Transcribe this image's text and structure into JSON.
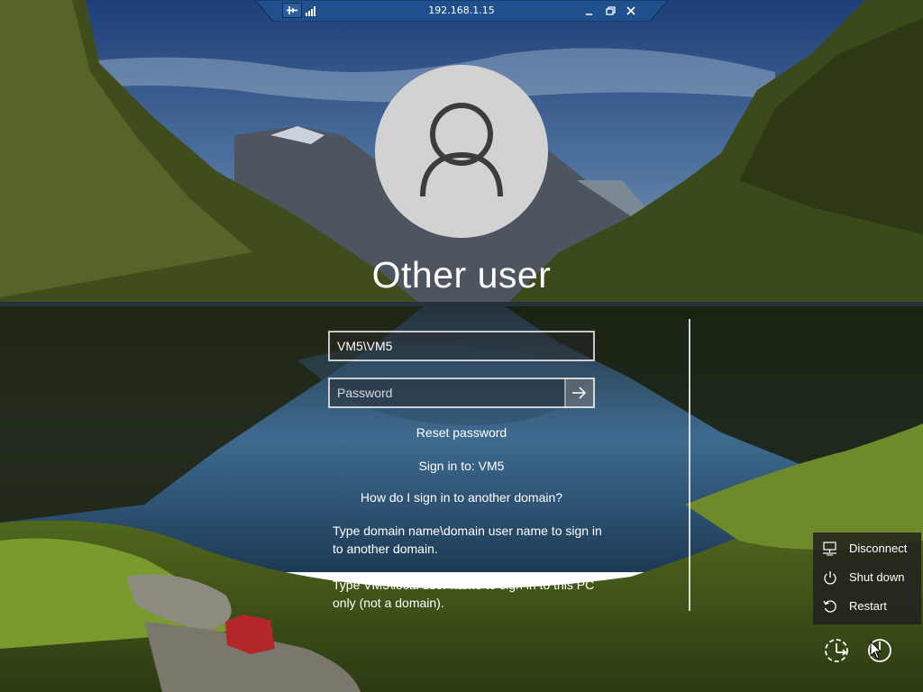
{
  "rdp_bar": {
    "title": "192.168.1.15"
  },
  "login": {
    "user_display_name": "Other user",
    "username_value": "VM5\\VM5",
    "password_placeholder": "Password",
    "reset_password": "Reset password",
    "sign_in_to": "Sign in to: VM5",
    "other_domain_link": "How do I sign in to another domain?",
    "info_domain": "Type domain name\\domain user name to sign in to another domain.",
    "info_local": "Type VM5\\local user name to sign in to this PC only (not a domain)."
  },
  "power_menu": {
    "items": [
      {
        "label": "Disconnect",
        "icon": "monitor-disconnect-icon"
      },
      {
        "label": "Shut down",
        "icon": "power-icon"
      },
      {
        "label": "Restart",
        "icon": "restart-icon"
      }
    ]
  },
  "corner_buttons": [
    {
      "icon": "ease-of-access-icon"
    },
    {
      "icon": "power-icon"
    }
  ],
  "colors": {
    "rdp_bar": "#1f4f8c",
    "avatar_bg": "#d2d2d2",
    "menu_bg": "#1e1e1e"
  }
}
